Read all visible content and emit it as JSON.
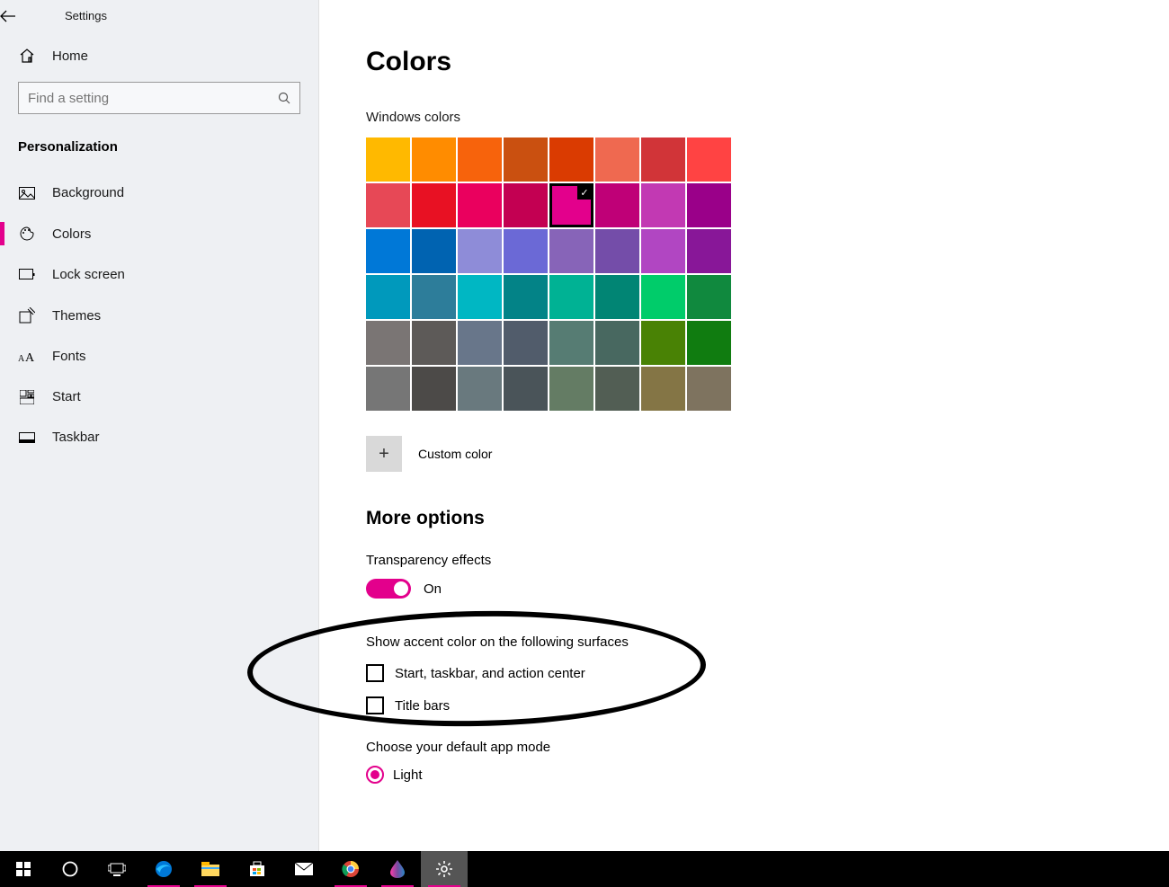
{
  "header": {
    "app_title": "Settings"
  },
  "sidebar": {
    "home_label": "Home",
    "search_placeholder": "Find a setting",
    "section_title": "Personalization",
    "items": [
      {
        "label": "Background",
        "icon": "picture-icon",
        "active": false
      },
      {
        "label": "Colors",
        "icon": "palette-icon",
        "active": true
      },
      {
        "label": "Lock screen",
        "icon": "monitor-icon",
        "active": false
      },
      {
        "label": "Themes",
        "icon": "pen-square-icon",
        "active": false
      },
      {
        "label": "Fonts",
        "icon": "font-icon",
        "active": false
      },
      {
        "label": "Start",
        "icon": "start-tiles-icon",
        "active": false
      },
      {
        "label": "Taskbar",
        "icon": "taskbar-icon",
        "active": false
      }
    ]
  },
  "main": {
    "title": "Colors",
    "windows_colors_label": "Windows colors",
    "color_grid": [
      [
        "#FFB900",
        "#FF8C00",
        "#F7630C",
        "#CA5010",
        "#DA3B01",
        "#EF6950",
        "#D13438",
        "#FF4343"
      ],
      [
        "#E74856",
        "#E81123",
        "#EA005E",
        "#C30052",
        "#E3008C",
        "#BF0077",
        "#C239B3",
        "#9A0089"
      ],
      [
        "#0078D7",
        "#0063B1",
        "#8E8CD8",
        "#6B69D6",
        "#8764B8",
        "#744DA9",
        "#B146C2",
        "#881798"
      ],
      [
        "#0099BC",
        "#2D7D9A",
        "#00B7C3",
        "#038387",
        "#00B294",
        "#018574",
        "#00CC6A",
        "#10893E"
      ],
      [
        "#7A7574",
        "#5D5A58",
        "#68768A",
        "#515C6B",
        "#567C73",
        "#486860",
        "#498205",
        "#107C10"
      ],
      [
        "#767676",
        "#4C4A48",
        "#69797E",
        "#4A5459",
        "#647C64",
        "#525E54",
        "#847545",
        "#7E735F"
      ]
    ],
    "selected_color_index": [
      1,
      4
    ],
    "custom_color_label": "Custom color",
    "more_options_label": "More options",
    "transparency_label": "Transparency effects",
    "transparency_state": "On",
    "accent_surfaces_label": "Show accent color on the following surfaces",
    "checkbox_start": "Start, taskbar, and action center",
    "checkbox_title": "Title bars",
    "default_mode_label": "Choose your default app mode",
    "default_mode_option": "Light"
  },
  "colors": {
    "accent": "#e3008c"
  },
  "taskbar": {
    "items": [
      {
        "name": "start-menu-icon"
      },
      {
        "name": "cortana-icon"
      },
      {
        "name": "task-view-icon"
      },
      {
        "name": "edge-browser-icon"
      },
      {
        "name": "file-explorer-icon"
      },
      {
        "name": "microsoft-store-icon"
      },
      {
        "name": "mail-icon"
      },
      {
        "name": "chrome-browser-icon"
      },
      {
        "name": "paint3d-icon"
      },
      {
        "name": "settings-icon"
      }
    ],
    "running_indices": [
      3,
      4,
      7,
      8,
      9
    ],
    "active_index": 9
  }
}
